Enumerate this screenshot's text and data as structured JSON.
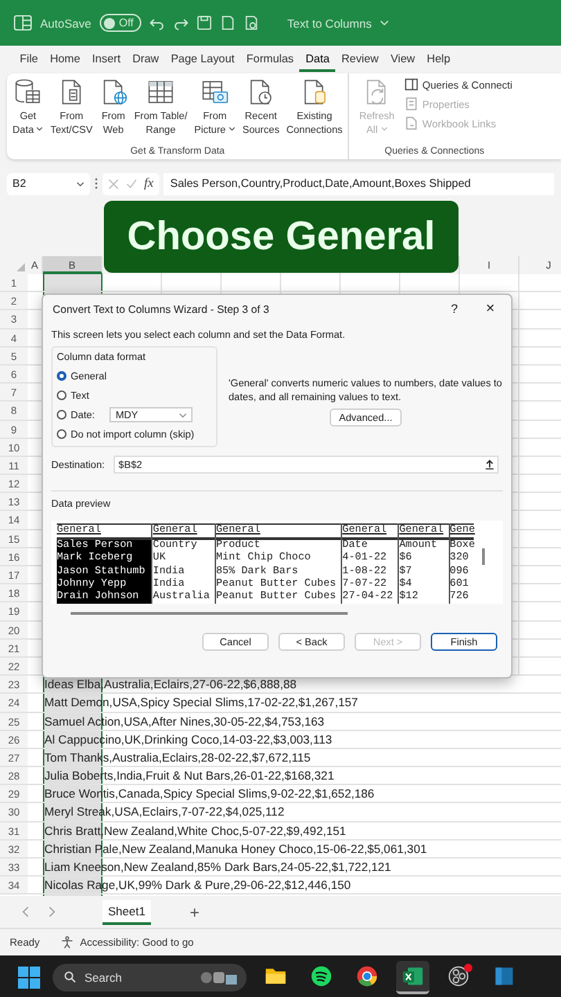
{
  "title_bar": {
    "autosave_label": "AutoSave",
    "autosave_toggle": {
      "label": "Off",
      "on": false
    },
    "document_title": "Text to Columns"
  },
  "ribbon_tabs": [
    {
      "label": "File",
      "selected": false
    },
    {
      "label": "Home",
      "selected": false
    },
    {
      "label": "Insert",
      "selected": false
    },
    {
      "label": "Draw",
      "selected": false
    },
    {
      "label": "Page Layout",
      "selected": false
    },
    {
      "label": "Formulas",
      "selected": false
    },
    {
      "label": "Data",
      "selected": true
    },
    {
      "label": "Review",
      "selected": false
    },
    {
      "label": "View",
      "selected": false
    },
    {
      "label": "Help",
      "selected": false
    }
  ],
  "ribbon": {
    "groups": [
      {
        "name": "Get & Transform Data",
        "large_buttons": [
          {
            "kind": "database",
            "lines": [
              "Get",
              "Data"
            ],
            "dropdown": true,
            "disabled": false
          },
          {
            "kind": "text",
            "lines": [
              "From",
              "Text/CSV"
            ],
            "dropdown": false,
            "disabled": false
          },
          {
            "kind": "web",
            "lines": [
              "From",
              "Web"
            ],
            "dropdown": false,
            "disabled": false
          },
          {
            "kind": "table",
            "lines": [
              "From Table/",
              "Range"
            ],
            "dropdown": false,
            "disabled": false
          },
          {
            "kind": "picture",
            "lines": [
              "From",
              "Picture"
            ],
            "dropdown": true,
            "disabled": false
          },
          {
            "kind": "recent",
            "lines": [
              "Recent",
              "Sources"
            ],
            "dropdown": false,
            "disabled": false
          },
          {
            "kind": "connections",
            "lines": [
              "Existing",
              "Connections"
            ],
            "dropdown": false,
            "disabled": false
          }
        ]
      },
      {
        "name": "Queries & Connections",
        "large_buttons": [
          {
            "kind": "refresh",
            "lines": [
              "Refresh",
              "All"
            ],
            "dropdown": true,
            "disabled": true
          }
        ],
        "small_buttons": [
          {
            "kind": "queries",
            "label": "Queries & Connecti",
            "disabled": false
          },
          {
            "kind": "properties",
            "label": "Properties",
            "disabled": true
          },
          {
            "kind": "links",
            "label": "Workbook Links",
            "disabled": true
          }
        ]
      }
    ]
  },
  "formula_bar": {
    "name_box": "B2",
    "function_label": "fx",
    "formula": "Sales Person,Country,Product,Date,Amount,Boxes Shipped"
  },
  "banner": "Choose General",
  "sheet": {
    "columns": [
      {
        "label": "A",
        "selected": false
      },
      {
        "label": "B",
        "selected": true
      },
      {
        "label": "I",
        "selected": false
      },
      {
        "label": "J",
        "selected": false
      }
    ],
    "rows": [
      {
        "number": "1"
      },
      {
        "number": "2"
      },
      {
        "number": "3"
      },
      {
        "number": "4"
      },
      {
        "number": "5"
      },
      {
        "number": "6"
      },
      {
        "number": "7"
      },
      {
        "number": "8"
      },
      {
        "number": "9"
      },
      {
        "number": "10"
      },
      {
        "number": "11"
      },
      {
        "number": "12"
      },
      {
        "number": "13"
      },
      {
        "number": "14"
      },
      {
        "number": "15"
      },
      {
        "number": "16"
      },
      {
        "number": "17"
      },
      {
        "number": "18"
      },
      {
        "number": "19"
      },
      {
        "number": "20"
      },
      {
        "number": "21"
      },
      {
        "number": "22"
      },
      {
        "number": "23",
        "text": "Ideas Elba,Australia,Eclairs,27-06-22,$6,888,88"
      },
      {
        "number": "24",
        "text": "Matt Demon,USA,Spicy Special Slims,17-02-22,$1,267,157"
      },
      {
        "number": "25",
        "text": "Samuel Action,USA,After Nines,30-05-22,$4,753,163"
      },
      {
        "number": "26",
        "text": "Al Cappuccino,UK,Drinking Coco,14-03-22,$3,003,113"
      },
      {
        "number": "27",
        "text": "Tom Thanks,Australia,Eclairs,28-02-22,$7,672,115"
      },
      {
        "number": "28",
        "text": "Julia Boberts,India,Fruit & Nut Bars,26-01-22,$168,321"
      },
      {
        "number": "29",
        "text": "Bruce Wontis,Canada,Spicy Special Slims,9-02-22,$1,652,186"
      },
      {
        "number": "30",
        "text": "Meryl Streak,USA,Eclairs,7-07-22,$4,025,112"
      },
      {
        "number": "31",
        "text": "Chris Bratt,New Zealand,White Choc,5-07-22,$9,492,151"
      },
      {
        "number": "32",
        "text": "Christian Pale,New Zealand,Manuka Honey Choco,15-06-22,$5,061,301"
      },
      {
        "number": "33",
        "text": "Liam Kneeson,New Zealand,85% Dark Bars,24-05-22,$1,722,121"
      },
      {
        "number": "34",
        "text": "Nicolas Rage,UK,99% Dark & Pure,29-06-22,$12,446,150"
      }
    ]
  },
  "dialog": {
    "title": "Convert Text to Columns Wizard - Step 3 of 3",
    "help": "?",
    "close": "×",
    "intro": "This screen lets you select each column and set the Data Format.",
    "format_group": {
      "legend": "Column data format",
      "date_format": "MDY",
      "options": [
        {
          "kind": "plain",
          "label": "General",
          "selected": true
        },
        {
          "kind": "plain",
          "label": "Text",
          "selected": false
        },
        {
          "kind": "date",
          "label": "Date:",
          "selected": false
        },
        {
          "kind": "plain",
          "label": "Do not import column (skip)",
          "selected": false
        }
      ]
    },
    "description": "'General' converts numeric values to numbers, date values to dates, and all remaining values to text.",
    "advanced_button": "Advanced...",
    "destination": {
      "label": "Destination:",
      "value": "$B$2"
    },
    "preview": {
      "legend": "Data preview",
      "columns": [
        {
          "header": "General",
          "selected": true,
          "cells": [
            "Sales Person",
            "Mark Iceberg",
            "Jason Stathumb",
            "Johnny Yepp",
            "Drain Johnson"
          ]
        },
        {
          "header": "General",
          "selected": false,
          "cells": [
            "Country",
            "UK",
            "India",
            "India",
            "Australia"
          ]
        },
        {
          "header": "General",
          "selected": false,
          "cells": [
            "Product",
            "Mint Chip Choco",
            "85% Dark Bars",
            "Peanut Butter Cubes",
            "Peanut Butter Cubes"
          ]
        },
        {
          "header": "General",
          "selected": false,
          "cells": [
            "Date",
            "4-01-22",
            "1-08-22",
            "7-07-22",
            "27-04-22"
          ]
        },
        {
          "header": "General",
          "selected": false,
          "cells": [
            "Amount",
            "$6",
            "$7",
            "$4",
            "$12"
          ]
        },
        {
          "header": "Gene",
          "selected": false,
          "cells": [
            "Boxe",
            "320",
            "096",
            "601",
            "726"
          ]
        }
      ]
    },
    "buttons": [
      {
        "label": "Cancel",
        "disabled": false,
        "default": false
      },
      {
        "label": "< Back",
        "disabled": false,
        "default": false
      },
      {
        "label": "Next >",
        "disabled": true,
        "default": false
      },
      {
        "label": "Finish",
        "disabled": false,
        "default": true
      }
    ]
  },
  "sheet_tabs": {
    "tabs": [
      {
        "label": "Sheet1",
        "selected": true
      }
    ],
    "add": "+"
  },
  "status_bar": {
    "ready": "Ready",
    "accessibility": "Accessibility: Good to go"
  },
  "taskbar": {
    "search_placeholder": "Search",
    "apps": [
      {
        "kind": "folder",
        "active": false,
        "notification": false
      },
      {
        "kind": "music",
        "active": false,
        "notification": false
      },
      {
        "kind": "browser",
        "active": false,
        "notification": false
      },
      {
        "kind": "spreadsheet",
        "active": true,
        "notification": false
      },
      {
        "kind": "recorder",
        "active": false,
        "notification": true
      },
      {
        "kind": "panel",
        "active": false,
        "notification": false
      }
    ]
  }
}
